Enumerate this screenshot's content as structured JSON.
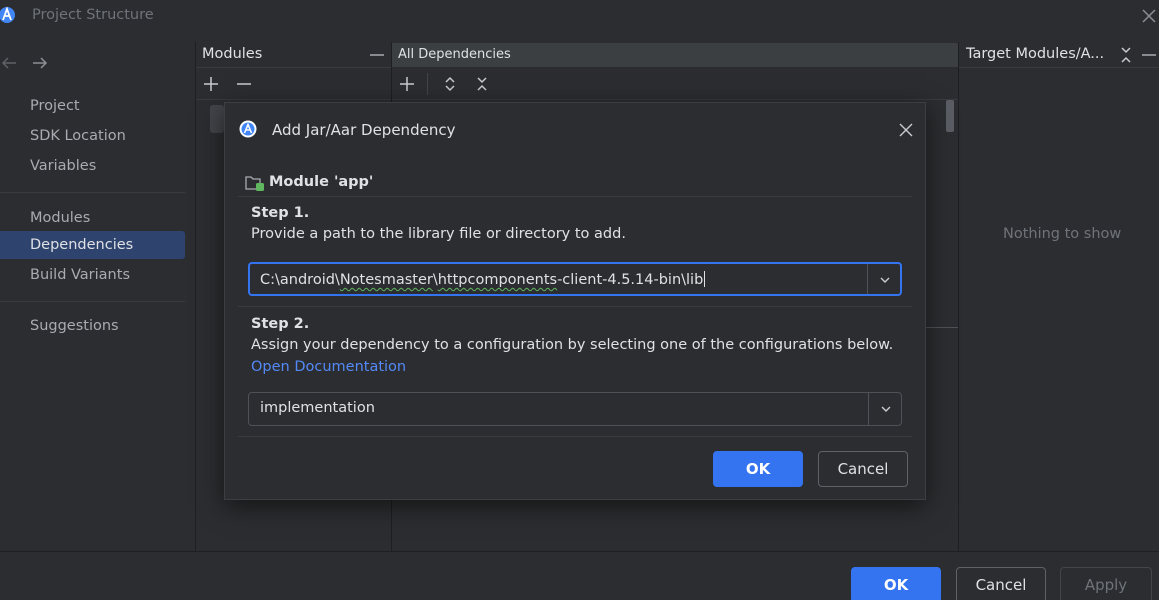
{
  "window": {
    "title": "Project Structure"
  },
  "nav": {
    "groups": [
      [
        "Project",
        "SDK Location",
        "Variables"
      ],
      [
        "Modules",
        "Dependencies",
        "Build Variants"
      ],
      [
        "Suggestions"
      ]
    ],
    "selected": "Dependencies"
  },
  "modules_panel": {
    "title": "Modules"
  },
  "deps_panel": {
    "title": "All Dependencies"
  },
  "target_panel": {
    "title": "Target Modules/A...",
    "empty_text": "Nothing to show"
  },
  "footer": {
    "ok": "OK",
    "cancel": "Cancel",
    "apply": "Apply"
  },
  "dialog": {
    "title": "Add Jar/Aar Dependency",
    "module": "Module 'app'",
    "step1": {
      "title": "Step 1.",
      "description": "Provide a path to the library file or directory to add.",
      "path_parts": [
        "C:\\android\\",
        "Notesmaster",
        "\\",
        "httpcomponents",
        "-client-4.5.14-bin\\lib"
      ]
    },
    "step2": {
      "title": "Step 2.",
      "description": "Assign your dependency to a configuration by selecting one of the configurations below.",
      "link": "Open Documentation",
      "configuration": "implementation"
    },
    "ok": "OK",
    "cancel": "Cancel"
  },
  "colors": {
    "accent": "#3574f0",
    "selection": "#2e436e",
    "link": "#548af7",
    "background": "#2b2d30"
  }
}
